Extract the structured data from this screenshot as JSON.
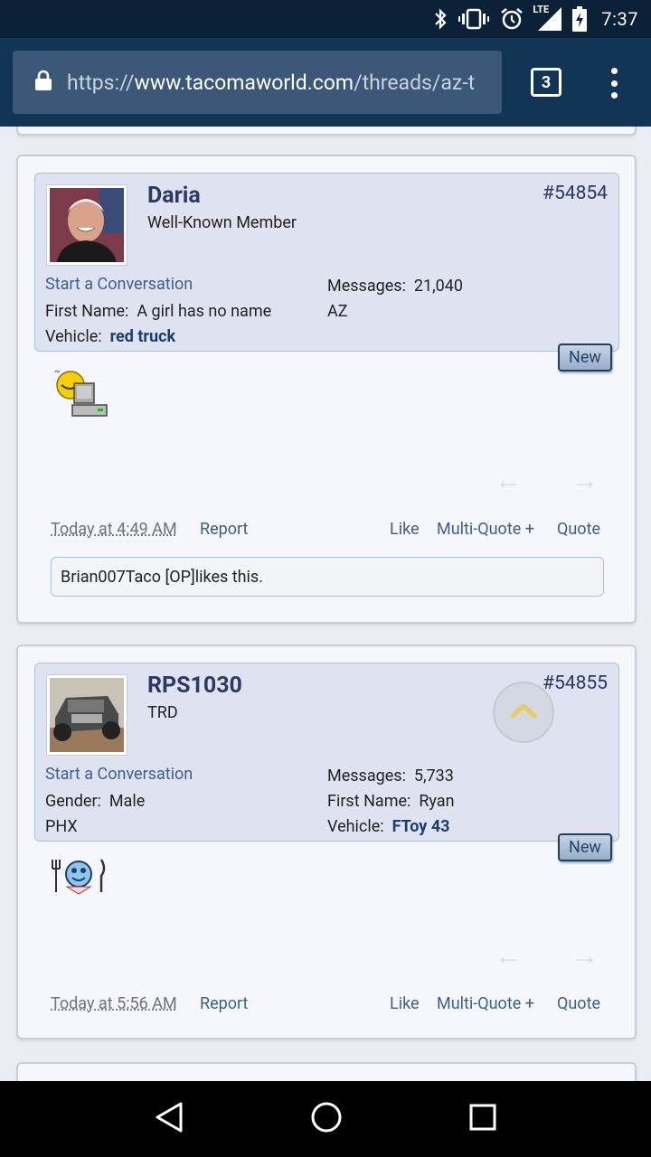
{
  "status_bar": {
    "time": "7:37",
    "network": "LTE"
  },
  "browser": {
    "url_scheme": "https://",
    "url_host": "www.tacomaworld.com",
    "url_path": "/threads/az-t",
    "tab_count": "3"
  },
  "posts": [
    {
      "username": "Daria",
      "user_title": "Well-Known Member",
      "post_number": "#54854",
      "start_conversation": "Start a Conversation",
      "left_fields": [
        {
          "label": "First Name:",
          "value": "A girl has no name"
        },
        {
          "label": "Vehicle:",
          "value": "red truck"
        }
      ],
      "right_fields": [
        {
          "label": "Messages:",
          "value": "21,040"
        },
        {
          "label": "",
          "value": "AZ"
        }
      ],
      "new_badge": "New",
      "timestamp": "Today at 4:49 AM",
      "report": "Report",
      "like": "Like",
      "multi_quote": "Multi-Quote +",
      "quote": "Quote",
      "likes_user": "Brian007Taco [OP]",
      "likes_text": " likes this."
    },
    {
      "username": "RPS1030",
      "user_title": "TRD",
      "post_number": "#54855",
      "start_conversation": "Start a Conversation",
      "left_fields": [
        {
          "label": "Gender:",
          "value": "Male"
        },
        {
          "label": "",
          "value": "PHX"
        }
      ],
      "right_fields": [
        {
          "label": "Messages:",
          "value": "5,733"
        },
        {
          "label": "First Name:",
          "value": "Ryan"
        },
        {
          "label": "Vehicle:",
          "value": "FToy 43"
        }
      ],
      "new_badge": "New",
      "timestamp": "Today at 5:56 AM",
      "report": "Report",
      "like": "Like",
      "multi_quote": "Multi-Quote +",
      "quote": "Quote"
    }
  ],
  "icons": {
    "bluetooth": "bluetooth-icon",
    "vibrate": "vibrate-icon",
    "alarm": "alarm-icon",
    "signal": "signal-icon",
    "battery": "battery-icon",
    "lock": "lock-icon",
    "menu": "overflow-menu-icon",
    "back": "back-nav-icon",
    "home": "home-nav-icon",
    "recents": "recents-nav-icon"
  }
}
